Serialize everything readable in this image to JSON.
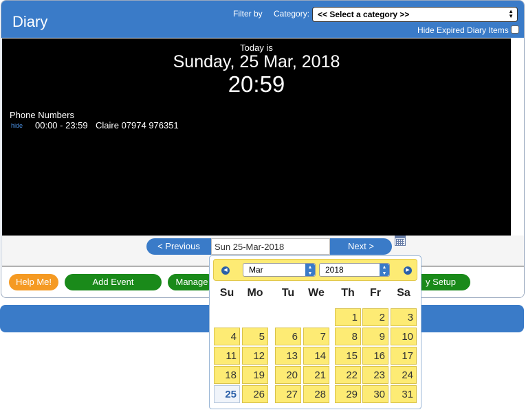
{
  "header": {
    "title": "Diary",
    "filter_label": "Filter by",
    "category_label": "Category:",
    "category_selected": "<< Select a category >>",
    "hide_expired_label": "Hide Expired Diary Items",
    "hide_expired_checked": false
  },
  "display": {
    "today_is": "Today is",
    "date": "Sunday, 25 Mar, 2018",
    "time": "20:59",
    "section_title": "Phone Numbers",
    "hide_link": "hide",
    "entries": [
      {
        "time_range": "00:00 - 23:59",
        "text": "Claire 07974 976351"
      }
    ]
  },
  "navigation": {
    "previous_label": "< Previous",
    "date_value": "Sun 25-Mar-2018",
    "next_label": "Next >"
  },
  "actions": {
    "help_label": "Help Me!",
    "add_event_label": "Add Event",
    "manage_label": "Manage",
    "setup_label": "y Setup"
  },
  "calendar": {
    "month": "Mar",
    "year": "2018",
    "weekdays": [
      "Su",
      "Mo",
      "Tu",
      "We",
      "Th",
      "Fr",
      "Sa"
    ],
    "first_weekday_index": 4,
    "days_in_month": 31,
    "today": 25,
    "highlight_color": "#fdeb74"
  },
  "colors": {
    "brand_blue": "#3a7bc8",
    "help_orange": "#f59a23",
    "action_green": "#1a8a1a"
  }
}
